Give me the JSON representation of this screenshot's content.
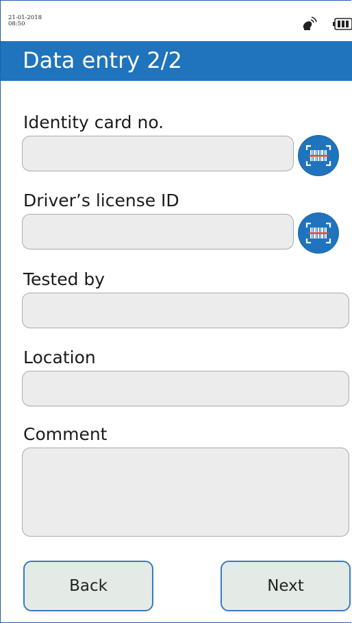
{
  "status_bar": {
    "date": "21-01-2018",
    "time": "08:50",
    "icons": [
      "satellite-icon",
      "battery-icon"
    ]
  },
  "header": {
    "title": "Data entry 2/2"
  },
  "form": {
    "identity_card": {
      "label": "Identity card no.",
      "value": ""
    },
    "drivers_license": {
      "label": "Driver’s license ID",
      "value": ""
    },
    "tested_by": {
      "label": "Tested by",
      "value": ""
    },
    "location": {
      "label": "Location",
      "value": ""
    },
    "comment": {
      "label": "Comment",
      "value": ""
    }
  },
  "buttons": {
    "back": "Back",
    "next": "Next"
  },
  "colors": {
    "accent": "#1f74bd",
    "field_bg": "#ececec",
    "button_bg": "#e4ebe6"
  }
}
